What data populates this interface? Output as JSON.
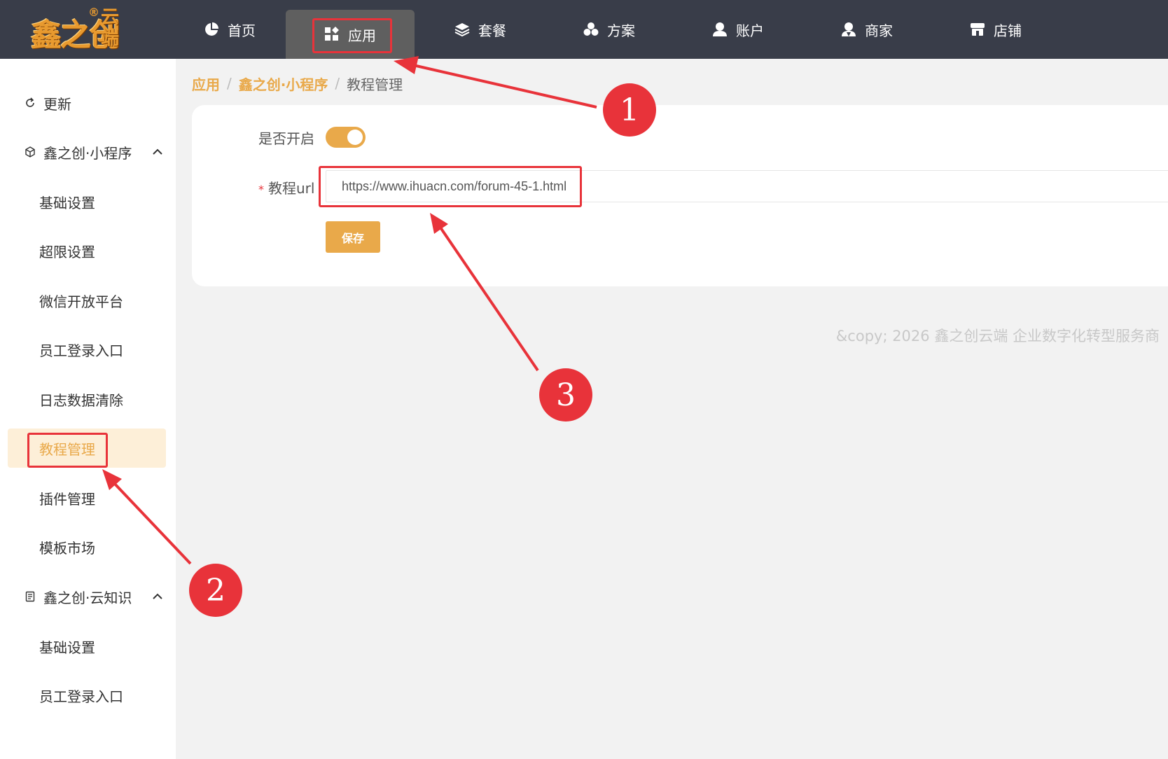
{
  "logo": {
    "main": "鑫之创",
    "side": "云端",
    "reg": "®"
  },
  "nav": [
    {
      "label": "首页",
      "icon": "pie-chart-icon"
    },
    {
      "label": "应用",
      "icon": "apps-grid-icon",
      "active": true
    },
    {
      "label": "套餐",
      "icon": "layers-icon"
    },
    {
      "label": "方案",
      "icon": "cubes-icon"
    },
    {
      "label": "账户",
      "icon": "user-icon"
    },
    {
      "label": "商家",
      "icon": "merchant-icon"
    },
    {
      "label": "店铺",
      "icon": "store-icon"
    }
  ],
  "sidebar": {
    "refresh": "更新",
    "group1": "鑫之创·小程序",
    "group1_items": [
      "基础设置",
      "超限设置",
      "微信开放平台",
      "员工登录入口",
      "日志数据清除",
      "教程管理",
      "插件管理",
      "模板市场"
    ],
    "group2": "鑫之创·云知识",
    "group2_items": [
      "基础设置",
      "员工登录入口"
    ]
  },
  "breadcrumb": {
    "l1": "应用",
    "l2": "鑫之创·小程序",
    "current": "教程管理",
    "sep": "/"
  },
  "form": {
    "enable_label": "是否开启",
    "enabled": true,
    "required_mark": "*",
    "url_label": "教程url",
    "url_value": "https://www.ihuacn.com/forum-45-1.html",
    "save_label": "保存"
  },
  "footer": "&copy; 2026 鑫之创云端 企业数字化转型服务商",
  "annotations": {
    "b1": "1",
    "b2": "2",
    "b3": "3"
  },
  "colors": {
    "accent": "#e9a94a",
    "topbar": "#393d49",
    "annotation": "#e8333a"
  }
}
